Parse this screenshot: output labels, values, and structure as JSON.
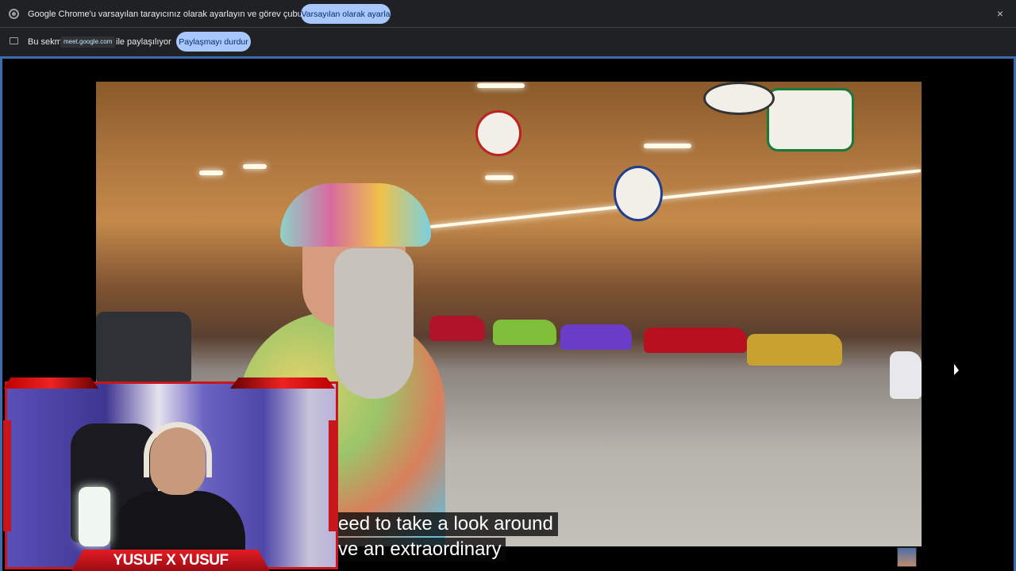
{
  "infobar_default": {
    "message": "Google Chrome'u varsayılan tarayıcınız olarak ayarlayın ve görev çubuğunuza sabitleyin",
    "button_label": "Varsayılan olarak ayarla",
    "close_icon": "×"
  },
  "infobar_share": {
    "prefix": "Bu sekme",
    "url": "meet.google.com",
    "suffix": "ile paylaşılıyor",
    "button_label": "Paylaşmayı durdur"
  },
  "video": {
    "caption_line1": "eed to take a look around",
    "caption_line2": "ve an extraordinary"
  },
  "webcam": {
    "name_banner": "YUSUF X YUSUF"
  },
  "colors": {
    "accent_button": "#a8c7fa",
    "frame_border": "#3b6cb0",
    "overlay_red": "#c8161d"
  }
}
